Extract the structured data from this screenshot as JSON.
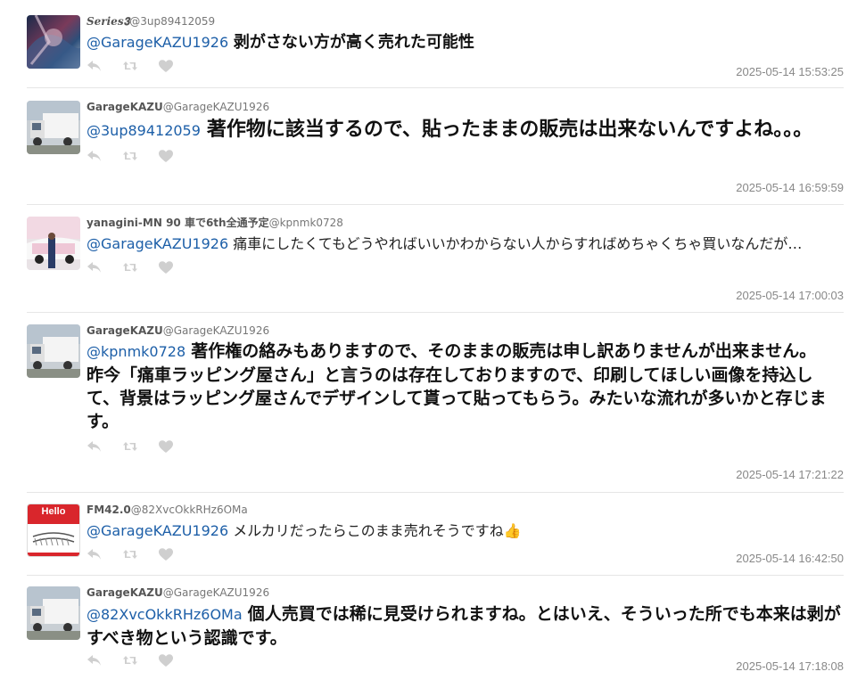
{
  "tweets": [
    {
      "name": "𝑺𝒆𝒓𝒊𝒆𝒔𝟑",
      "handle": "@3up89412059",
      "mention": "@GarageKAZU1926",
      "text": "剥がさない方が高く売れた可能性",
      "time": "2025-05-14 15:53:25"
    },
    {
      "name": "GarageKAZU",
      "handle": "@GarageKAZU1926",
      "mention": "@3up89412059",
      "text": "著作物に該当するので、貼ったままの販売は出来ないんですよね。。。",
      "time": "2025-05-14 16:59:59"
    },
    {
      "name": "yanagini-MN 90 車で6th全通予定",
      "handle": "@kpnmk0728",
      "mention": "@GarageKAZU1926",
      "text": "痛車にしたくてもどうやればいいかわからない人からすればめちゃくちゃ買いなんだが…",
      "time": "2025-05-14 17:00:03"
    },
    {
      "name": "GarageKAZU",
      "handle": "@GarageKAZU1926",
      "mention": "@kpnmk0728",
      "text": "著作権の絡みもありますので、そのままの販売は申し訳ありませんが出来ません。",
      "text2": "昨今「痛車ラッピング屋さん」と言うのは存在しておりますので、印刷してほしい画像を持込して、背景はラッピング屋さんでデザインして貰って貼ってもらう。みたいな流れが多いかと存じます。",
      "time": "2025-05-14 17:21:22"
    },
    {
      "name": "FM42.0",
      "handle": "@82XvcOkkRHz6OMa",
      "mention": "@GarageKAZU1926",
      "text": "メルカリだったらこのまま売れそうですね👍",
      "time": "2025-05-14 16:42:50",
      "avatar_text": "Hello"
    },
    {
      "name": "GarageKAZU",
      "handle": "@GarageKAZU1926",
      "mention": "@82XvcOkkRHz6OMa",
      "text": "個人売買では稀に見受けられますね。とはいえ、そういった所でも本来は剥がすべき物という認識です。",
      "time": "2025-05-14 17:18:08"
    }
  ],
  "colors": {
    "mention": "#1d5fa8",
    "icon": "#c8c8c8",
    "time": "#888888"
  },
  "icons": [
    "reply-icon",
    "retweet-icon",
    "like-icon"
  ]
}
